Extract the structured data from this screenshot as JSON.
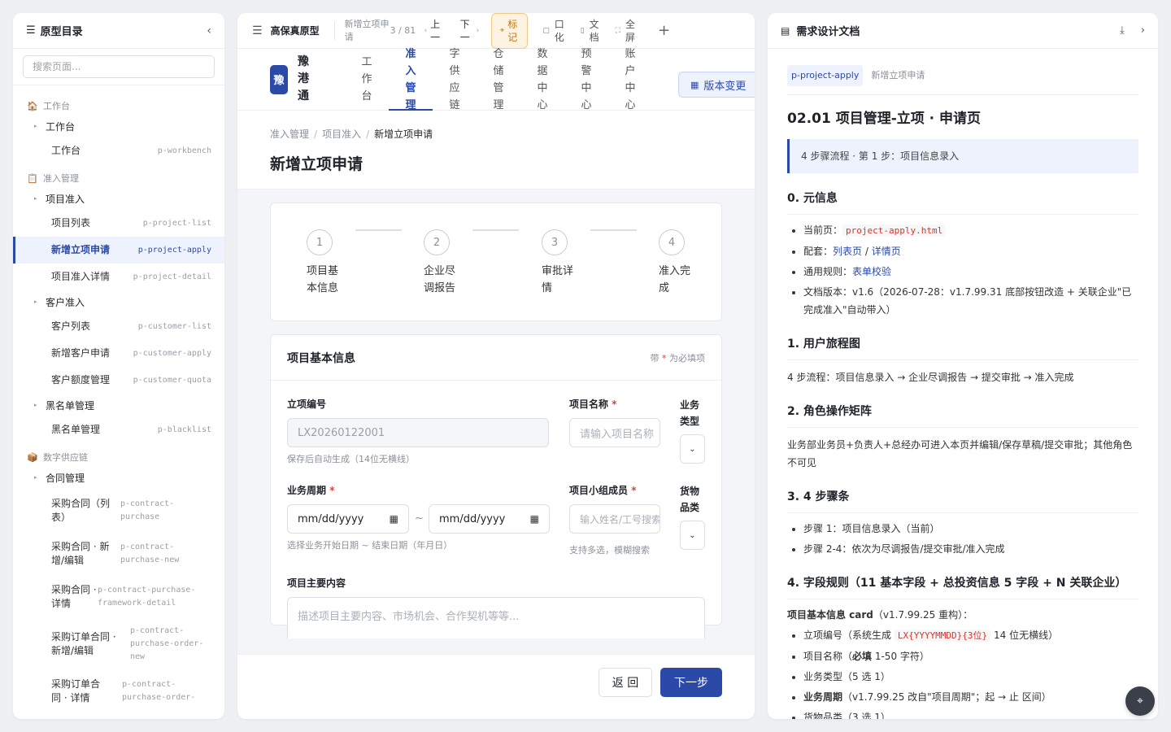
{
  "left": {
    "title": "原型目录",
    "collapse_icon": "chevron-left-icon",
    "search_placeholder": "搜索页面...",
    "groups": [
      {
        "label": "工作台",
        "icon": "🏠"
      },
      {
        "label": "准入管理",
        "icon": "📋"
      },
      {
        "label": "数字供应链",
        "icon": "📦"
      }
    ],
    "subs": [
      "工作台",
      "项目准入",
      "客户准入",
      "黑名单管理",
      "合同管理"
    ],
    "leaves": [
      {
        "name": "工作台",
        "code": "p-workbench"
      },
      {
        "name": "项目列表",
        "code": "p-project-list"
      },
      {
        "name": "新增立项申请",
        "code": "p-project-apply"
      },
      {
        "name": "项目准入详情",
        "code": "p-project-detail"
      },
      {
        "name": "客户列表",
        "code": "p-customer-list"
      },
      {
        "name": "新增客户申请",
        "code": "p-customer-apply"
      },
      {
        "name": "客户额度管理",
        "code": "p-customer-quota"
      },
      {
        "name": "黑名单管理",
        "code": "p-blacklist"
      },
      {
        "name": "采购合同（列表）",
        "code": "p-contract-purchase"
      },
      {
        "name": "采购合同 · 新增/编辑",
        "code": "p-contract-purchase-new"
      },
      {
        "name": "采购合同 · 详情",
        "code": "p-contract-purchase-framework-detail"
      },
      {
        "name": "采购订单合同 · 新增/编辑",
        "code": "p-contract-purchase-order-new"
      },
      {
        "name": "采购订单合同 · 详情",
        "code": "p-contract-purchase-order-"
      }
    ]
  },
  "toolbar": {
    "brand": "高保真原型",
    "page": "新增立项申请",
    "count": "3 / 81",
    "prev": "上一",
    "next": "下一",
    "mark": "标记",
    "tools": [
      "口化",
      "文档",
      "全屏"
    ],
    "plus": "+"
  },
  "app": {
    "logo": "豫",
    "name": "豫港通",
    "nav": [
      "工作台",
      "准入管理",
      "字供应链",
      "仓储管理",
      "数据中心",
      "预警中心",
      "账户中心"
    ],
    "nav_active": 1,
    "version_btn": "版本变更"
  },
  "page": {
    "breadcrumb": [
      "准入管理",
      "项目准入",
      "新增立项申请"
    ],
    "title": "新增立项申请"
  },
  "steps": [
    {
      "num": "1",
      "label": "项目基本信息"
    },
    {
      "num": "2",
      "label": "企业尽调报告"
    },
    {
      "num": "3",
      "label": "审批详情"
    },
    {
      "num": "4",
      "label": "准入完成"
    }
  ],
  "form": {
    "title": "项目基本信息",
    "note_prefix": "带",
    "note_star": "*",
    "note_suffix": "为必填项",
    "code_label": "立项编号",
    "code_value": "LX20260122001",
    "code_hint": "保存后自动生成（14位无横线）",
    "name_label": "项目名称",
    "name_placeholder": "请输入项目名称",
    "type_label": "业务类型",
    "period_label": "业务周期",
    "date_placeholder": "mm/dd/yyyy",
    "tilde": "~",
    "period_hint": "选择业务开始日期 ~ 结束日期（年月日）",
    "team_label": "项目小组成员",
    "team_placeholder": "输入姓名/工号搜索",
    "team_hint": "支持多选，模糊搜索",
    "goods_label": "货物品类",
    "content_label": "项目主要内容",
    "content_placeholder": "描述项目主要内容、市场机会、合作契机等等...",
    "star": "*"
  },
  "footer": {
    "back": "返 回",
    "next": "下一步"
  },
  "doc": {
    "title": "需求设计文档",
    "tag": "p-project-apply",
    "tag2": "新增立项申请",
    "h1": "02.01 项目管理-立项 · 申请页",
    "callout": "4 步骤流程 · 第 1 步：项目信息录入",
    "s0": "0. 元信息",
    "s0_items": {
      "cur_label": "当前页：",
      "cur_code": "project-apply.html",
      "pair_label": "配套：",
      "pair_a": "列表页",
      "pair_sep": " / ",
      "pair_b": "详情页",
      "rule_label": "通用规则：",
      "rule_link": "表单校验",
      "version": "文档版本：v1.6（2026-07-28：v1.7.99.31 底部按钮改造 + 关联企业\"已完成准入\"自动带入）"
    },
    "s1": "1. 用户旅程图",
    "s1_text": "4 步流程：项目信息录入 → 企业尽调报告 → 提交审批 → 准入完成",
    "s2": "2. 角色操作矩阵",
    "s2_text": "业务部业务员+负责人+总经办可进入本页并编辑/保存草稿/提交审批；其他角色不可见",
    "s3": "3. 4 步骤条",
    "s3_items": [
      "步骤 1：项目信息录入（当前）",
      "步骤 2-4：依次为尽调报告/提交审批/准入完成"
    ],
    "s4": "4. 字段规则（11 基本字段 + 总投资信息 5 字段 + N 关联企业）",
    "s4_lead_b": "项目基本信息 card",
    "s4_lead": "（v1.7.99.25 重构）：",
    "s4_i1a": "立项编号（系统生成 ",
    "s4_i1code": "LX{YYYYMMDD}{3位}",
    "s4_i1b": " 14 位无横线）",
    "s4_i2a": "项目名称（",
    "s4_i2b": "必填",
    "s4_i2c": " 1-50 字符）",
    "s4_i3": "业务类型（5 选 1）",
    "s4_i4b": "业务周期",
    "s4_i4": "（v1.7.99.25 改自\"项目周期\"；起 → 止 区间）",
    "s4_i5": "货物品类（3 选 1）"
  }
}
